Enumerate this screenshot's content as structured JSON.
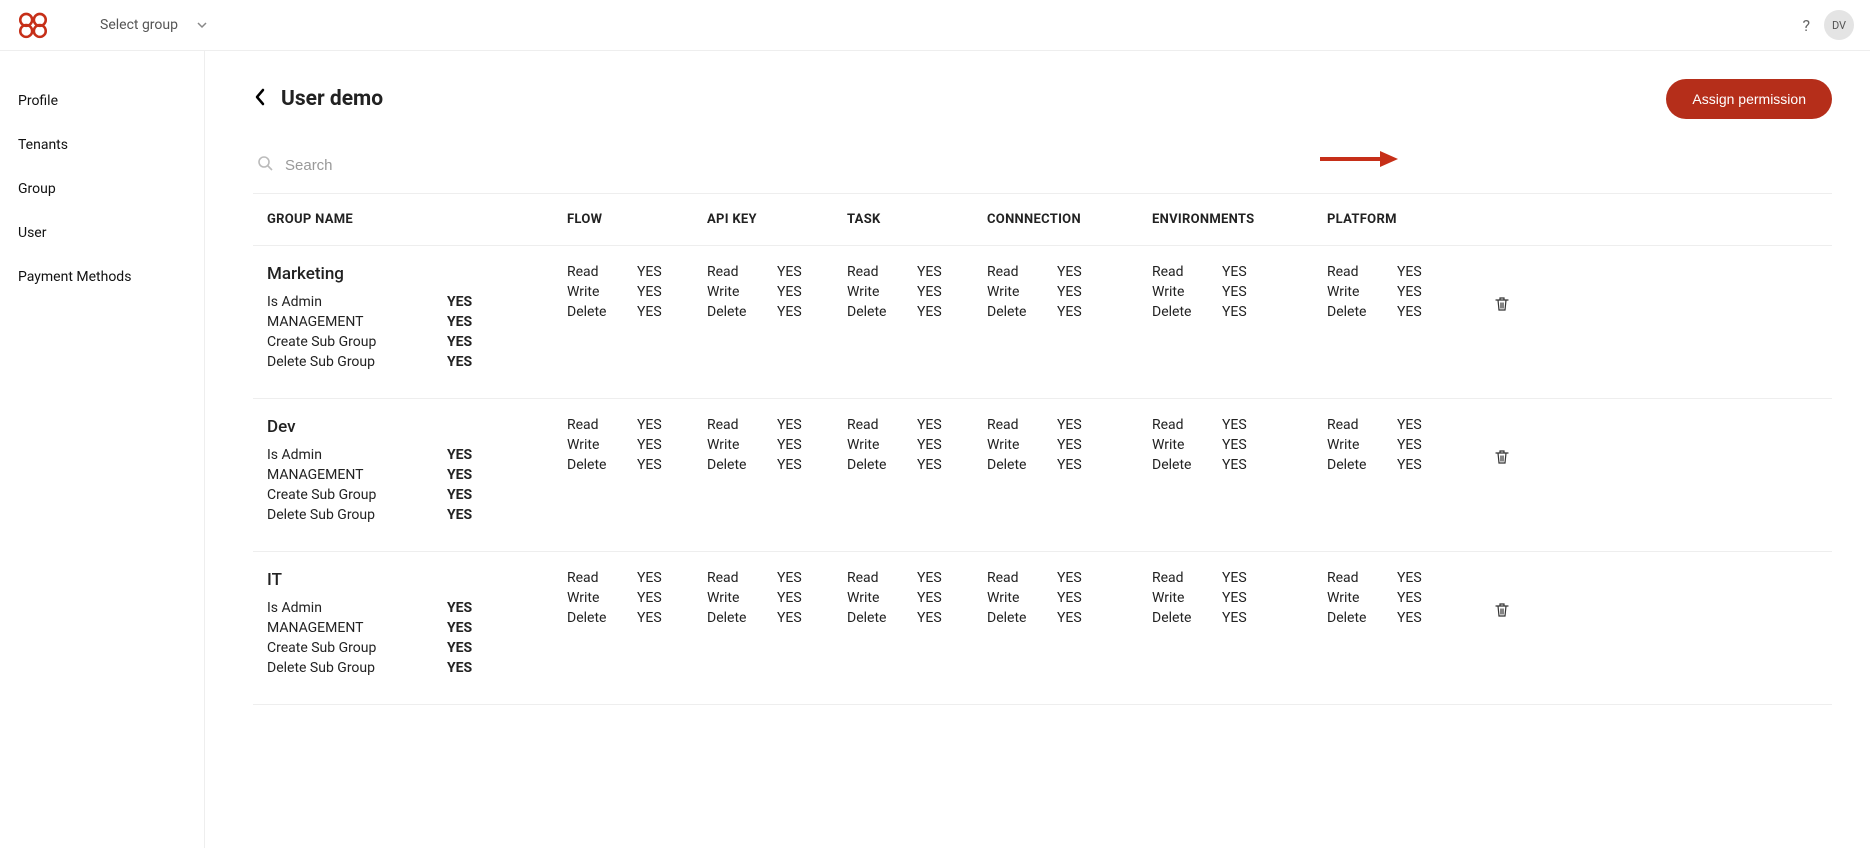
{
  "header": {
    "select_group_label": "Select group",
    "avatar_initials": "DV"
  },
  "sidebar": {
    "items": [
      {
        "label": "Profile"
      },
      {
        "label": "Tenants"
      },
      {
        "label": "Group"
      },
      {
        "label": "User"
      },
      {
        "label": "Payment Methods"
      }
    ]
  },
  "page": {
    "title": "User demo",
    "assign_button": "Assign permission",
    "search_placeholder": "Search"
  },
  "columns": {
    "group_name": "GROUP NAME",
    "flow": "FLOW",
    "api_key": "API KEY",
    "task": "TASK",
    "connection": "CONNNECTION",
    "environments": "ENVIRONMENTS",
    "platform": "PLATFORM"
  },
  "perm_labels": {
    "read": "Read",
    "write": "Write",
    "delete": "Delete"
  },
  "group_attr_labels": {
    "is_admin": "Is Admin",
    "management": "MANAGEMENT",
    "create_sub": "Create Sub Group",
    "delete_sub": "Delete Sub Group"
  },
  "groups": [
    {
      "name": "Marketing",
      "attrs": {
        "is_admin": "YES",
        "management": "YES",
        "create_sub": "YES",
        "delete_sub": "YES"
      },
      "perms": {
        "flow": {
          "read": "YES",
          "write": "YES",
          "delete": "YES"
        },
        "api_key": {
          "read": "YES",
          "write": "YES",
          "delete": "YES"
        },
        "task": {
          "read": "YES",
          "write": "YES",
          "delete": "YES"
        },
        "connection": {
          "read": "YES",
          "write": "YES",
          "delete": "YES"
        },
        "environments": {
          "read": "YES",
          "write": "YES",
          "delete": "YES"
        },
        "platform": {
          "read": "YES",
          "write": "YES",
          "delete": "YES"
        }
      }
    },
    {
      "name": "Dev",
      "attrs": {
        "is_admin": "YES",
        "management": "YES",
        "create_sub": "YES",
        "delete_sub": "YES"
      },
      "perms": {
        "flow": {
          "read": "YES",
          "write": "YES",
          "delete": "YES"
        },
        "api_key": {
          "read": "YES",
          "write": "YES",
          "delete": "YES"
        },
        "task": {
          "read": "YES",
          "write": "YES",
          "delete": "YES"
        },
        "connection": {
          "read": "YES",
          "write": "YES",
          "delete": "YES"
        },
        "environments": {
          "read": "YES",
          "write": "YES",
          "delete": "YES"
        },
        "platform": {
          "read": "YES",
          "write": "YES",
          "delete": "YES"
        }
      }
    },
    {
      "name": "IT",
      "attrs": {
        "is_admin": "YES",
        "management": "YES",
        "create_sub": "YES",
        "delete_sub": "YES"
      },
      "perms": {
        "flow": {
          "read": "YES",
          "write": "YES",
          "delete": "YES"
        },
        "api_key": {
          "read": "YES",
          "write": "YES",
          "delete": "YES"
        },
        "task": {
          "read": "YES",
          "write": "YES",
          "delete": "YES"
        },
        "connection": {
          "read": "YES",
          "write": "YES",
          "delete": "YES"
        },
        "environments": {
          "read": "YES",
          "write": "YES",
          "delete": "YES"
        },
        "platform": {
          "read": "YES",
          "write": "YES",
          "delete": "YES"
        }
      }
    }
  ]
}
